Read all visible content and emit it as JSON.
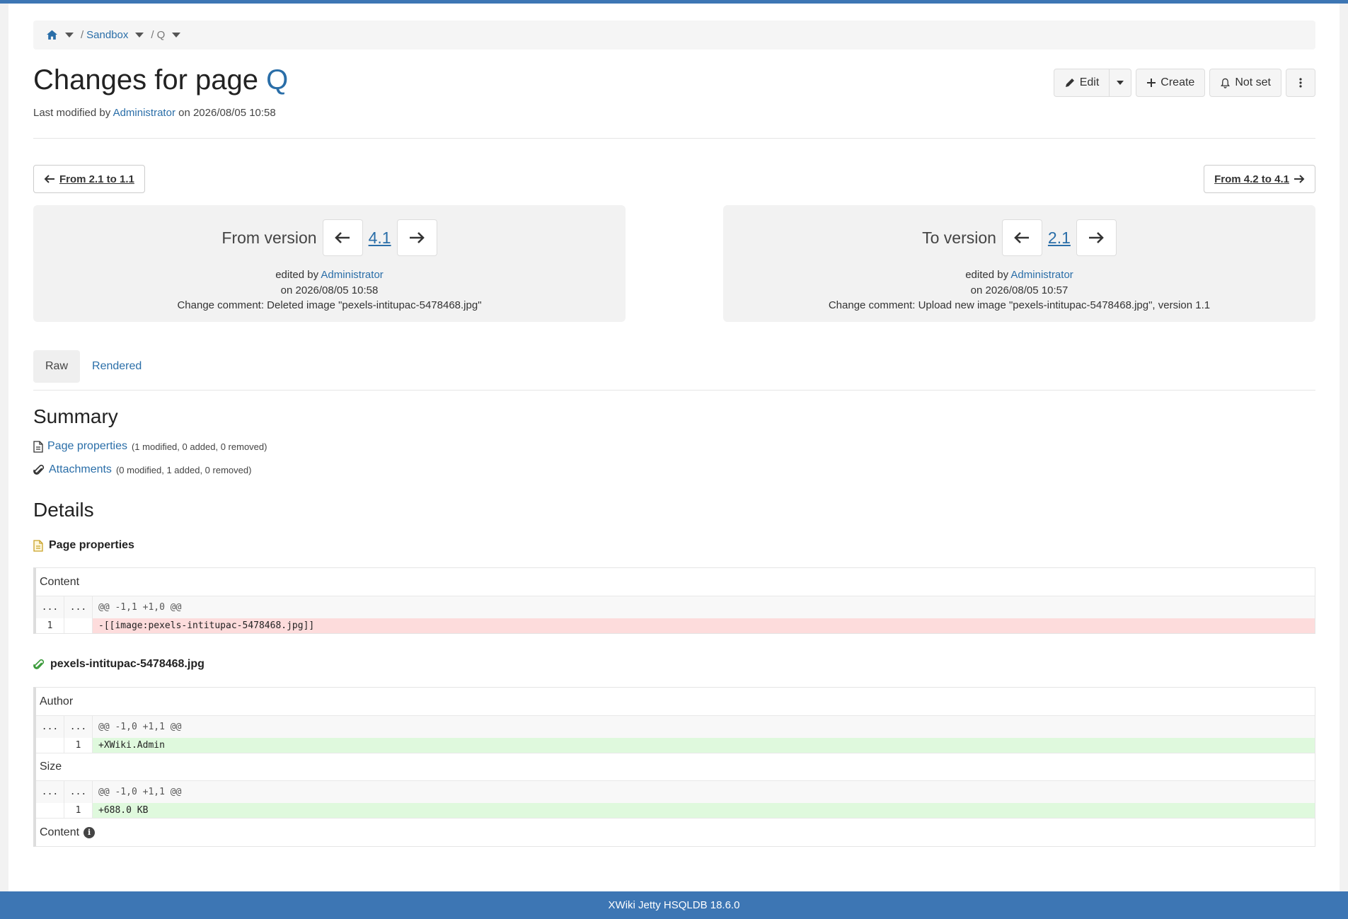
{
  "breadcrumb": {
    "items": [
      "Sandbox",
      "Q"
    ]
  },
  "title": {
    "prefix": "Changes for page ",
    "page": "Q"
  },
  "last_modified": {
    "prefix": "Last modified by ",
    "user": "Administrator",
    "suffix": " on 2026/08/05 10:58"
  },
  "actions": {
    "edit": "Edit",
    "create": "Create",
    "notify": "Not set"
  },
  "nav": {
    "prev": "From 2.1 to 1.1",
    "next": "From 4.2 to 4.1"
  },
  "from_version": {
    "label": "From version",
    "version": "4.1",
    "edited_by_prefix": "edited by ",
    "edited_by": "Administrator",
    "date": "on 2026/08/05 10:58",
    "comment": "Change comment: Deleted image \"pexels-intitupac-5478468.jpg\""
  },
  "to_version": {
    "label": "To version",
    "version": "2.1",
    "edited_by_prefix": "edited by ",
    "edited_by": "Administrator",
    "date": "on 2026/08/05 10:57",
    "comment": "Change comment: Upload new image \"pexels-intitupac-5478468.jpg\", version 1.1"
  },
  "tabs": [
    "Raw",
    "Rendered"
  ],
  "summary": {
    "heading": "Summary",
    "items": [
      {
        "label": "Page properties",
        "detail": "(1 modified, 0 added, 0 removed)"
      },
      {
        "label": "Attachments",
        "detail": "(0 modified, 1 added, 0 removed)"
      }
    ]
  },
  "details": {
    "heading": "Details",
    "page_properties": {
      "title": "Page properties",
      "content": {
        "label": "Content",
        "hunk_ln1": "...",
        "hunk_ln2": "...",
        "hunk": "@@ -1,1 +1,0 @@",
        "line_num": "1",
        "line": "-[[image:pexels-intitupac-5478468.jpg]]"
      }
    },
    "attachment": {
      "title": "pexels-intitupac-5478468.jpg",
      "author": {
        "label": "Author",
        "hunk_ln1": "...",
        "hunk_ln2": "...",
        "hunk": "@@ -1,0 +1,1 @@",
        "line_num": "1",
        "line": "+XWiki.Admin"
      },
      "size": {
        "label": "Size",
        "hunk_ln1": "...",
        "hunk_ln2": "...",
        "hunk": "@@ -1,0 +1,1 @@",
        "line_num": "1",
        "line": "+688.0 KB"
      },
      "content_label": "Content"
    }
  },
  "footer": "XWiki Jetty HSQLDB 18.6.0",
  "colors": {
    "brand": "#3d76b4",
    "link": "#2a6ea8",
    "deleted": "#fddcdc",
    "added": "#dff9dd"
  }
}
